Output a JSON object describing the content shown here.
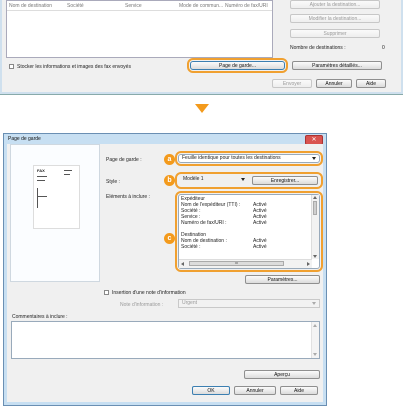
{
  "top_dialog": {
    "columns": [
      "Nom de destination",
      "Société",
      "Service",
      "Mode de commun...",
      "Numéro de fax/URI"
    ],
    "buttons": {
      "add_destination": "Ajouter la destination...",
      "modify_destination": "Modifier la destination...",
      "delete": "Supprimer",
      "cover_page": "Page de garde...",
      "advanced_settings": "Paramètres détaillés...",
      "send": "Envoyer",
      "cancel": "Annuler",
      "help": "Aide"
    },
    "destination_count_label": "Nombre de destinations :",
    "destination_count_value": "0",
    "store_fax_checkbox_label": "Stocker les informations et images des fax envoyés"
  },
  "cover_dialog": {
    "title": "Page de garde",
    "cover_page_label": "Page de garde :",
    "cover_page_value": "Feuille identique pour toutes les destinations",
    "style_label": "Style :",
    "style_value": "Modèle 1",
    "register_button": "Enregistrer...",
    "elements_label": "Eléments à inclure :",
    "elements_list": [
      {
        "name": "Expéditeur",
        "value": ""
      },
      {
        "name": "Nom de l'expéditeur (TTI) :",
        "value": "Activé"
      },
      {
        "name": "Société :",
        "value": "Activé"
      },
      {
        "name": "Service :",
        "value": "Activé"
      },
      {
        "name": "Numéro de fax/URI :",
        "value": "Activé"
      },
      {
        "name": "",
        "value": ""
      },
      {
        "name": "Destination",
        "value": ""
      },
      {
        "name": "Nom de destination :",
        "value": "Activé"
      },
      {
        "name": "Société :",
        "value": "Activé"
      }
    ],
    "scroll_value": "III",
    "params_button": "Paramètres...",
    "insert_info_checkbox_label": "Insertion d'une note d'information",
    "info_note_label": "Note d'information :",
    "info_note_value": "Urgent",
    "comments_label": "Commentaires à inclure :",
    "preview_button": "Aperçu",
    "ok_button": "OK",
    "cancel_button": "Annuler",
    "help_button": "Aide",
    "preview_text": "FAX"
  },
  "badges": {
    "a": "a",
    "b": "b",
    "c": "c"
  },
  "colors": {
    "accent": "#f39a1c",
    "titlebar": "#c7dff2",
    "close": "#d9534f"
  }
}
